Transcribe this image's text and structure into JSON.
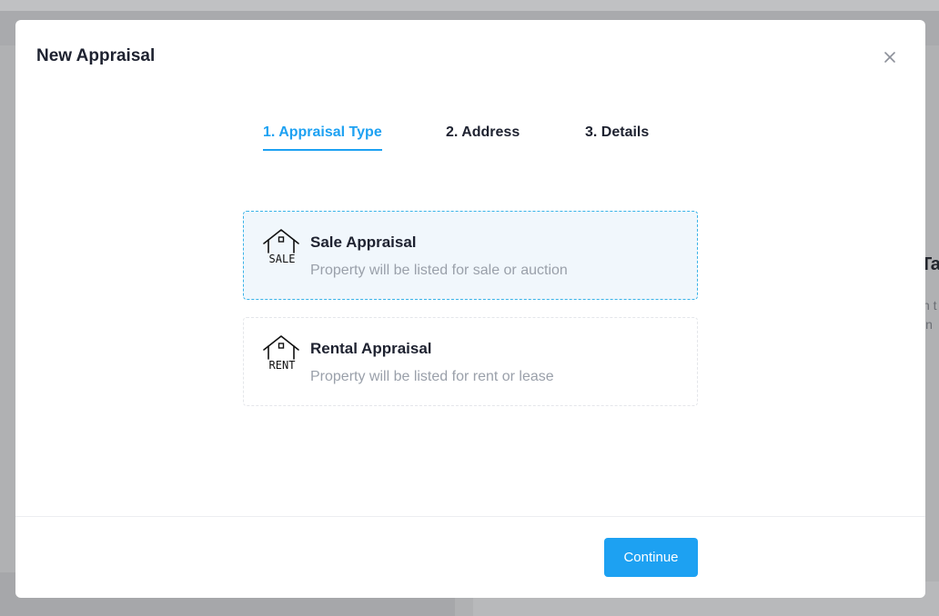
{
  "background": {
    "side_heading": "Ta",
    "side_lines": [
      "n t",
      "in"
    ]
  },
  "modal": {
    "title": "New Appraisal",
    "close_icon": "close-icon",
    "steps": [
      {
        "label": "1. Appraisal Type",
        "active": true
      },
      {
        "label": "2. Address",
        "active": false
      },
      {
        "label": "3. Details",
        "active": false
      }
    ],
    "options": [
      {
        "title": "Sale Appraisal",
        "description": "Property will be listed for sale or auction",
        "icon": "house-sale-icon",
        "badge": "SALE",
        "selected": true
      },
      {
        "title": "Rental Appraisal",
        "description": "Property will be listed for rent or lease",
        "icon": "house-rent-icon",
        "badge": "RENT",
        "selected": false
      }
    ],
    "continue_label": "Continue"
  },
  "colors": {
    "accent": "#1da1f2",
    "selected_border": "#39b3e8",
    "selected_bg": "#f1f7fc",
    "muted_text": "#9aa0aa"
  }
}
